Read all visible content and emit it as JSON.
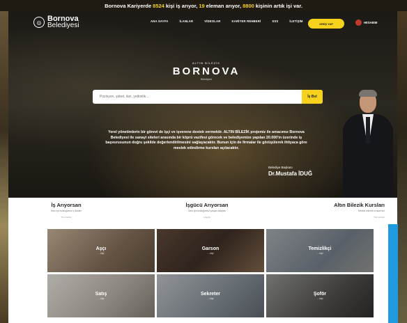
{
  "topbar": {
    "pre": "Bornova Kariyerde",
    "jobseekers": "8524",
    "mid1": "kişi iş arıyor,",
    "employers": "19",
    "mid2": "eleman arıyor,",
    "hired": "8800",
    "post": "kişinin artık işi var."
  },
  "logo": {
    "line1": "Bornova",
    "line2": "Belediyesi"
  },
  "menu": [
    "ANA SAYFA",
    "İLANLAR",
    "VİDEOLAR",
    "KARİYER REHBERİ",
    "SSS",
    "İLETİŞİM"
  ],
  "login_label": "GİRİŞ YAP",
  "account_label": "HESABIM",
  "brand": {
    "kicker": "ALTIN BİLEZİK",
    "name": "BORNOVA",
    "sub": "Belediyesi"
  },
  "search": {
    "placeholder": "Pozisyon, şirket, ilan, yetkinlik...",
    "button": "İş Bul"
  },
  "description": "Yerel yönetimlerin bir görevi de işçi ve işverene destek vermektir. ALTIN BİLEZİK projemiz ile amacımız Bornova Belediyesi ile sanayi siteleri arasında bir köprü vazifesi görecek ve belediyemize yapılan 20.000'in üzerinde iş başvurusunun doğru şekilde değerlendirilmesini sağlayacaktır. Bunun için de firmalar ile görüşülerek ihtiyaca göre meslek edindirme kursları açılacaktır.",
  "mayor": {
    "role": "Belediye Başkanı",
    "name": "Dr.Mustafa İDUĞ"
  },
  "columns": [
    {
      "title": "İş Arıyorsan",
      "subtitle": "Sizin için bulduğumuz iş ilanları",
      "link": "Tüm ilanlar"
    },
    {
      "title": "İşgücü Arıyorsan",
      "subtitle": "Sizin için bulduğumuz çalışan adayları",
      "link": "Adaylar"
    },
    {
      "title": "Altın Bilezik Kursları",
      "subtitle": "Meslek edinme kurslarımız",
      "link": "Tüm kurslar"
    }
  ],
  "categories": [
    {
      "name": "Aşçı",
      "count": "... kişi"
    },
    {
      "name": "Garson",
      "count": "... kişi"
    },
    {
      "name": "Temizlikçi",
      "count": "... kişi"
    },
    {
      "name": "Satış",
      "count": "... kişi"
    },
    {
      "name": "Sekreter",
      "count": "... kişi"
    },
    {
      "name": "Şoför",
      "count": "... kişi"
    }
  ],
  "colors": {
    "accent": "#f6d21c",
    "side_accent": "#1f9ae0"
  },
  "icons": {
    "logo_emblem": "municipality-emblem-icon",
    "account": "user-icon"
  }
}
